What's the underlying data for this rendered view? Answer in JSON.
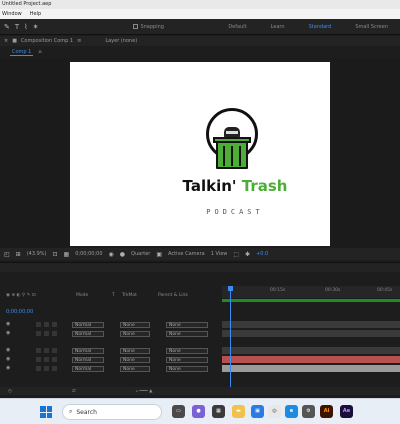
{
  "window": {
    "title": "Untitled Project.aep"
  },
  "menu": [
    "Window",
    "Help"
  ],
  "toolbar": {
    "tools": [
      "pen-tool",
      "text-tool",
      "brush-tool",
      "puppet-tool"
    ],
    "snapping_label": "Snapping",
    "workspaces": [
      {
        "label": "Default",
        "active": false
      },
      {
        "label": "Learn",
        "active": false
      },
      {
        "label": "Standard",
        "active": true
      },
      {
        "label": "Small Screen",
        "active": false
      }
    ]
  },
  "comp_panel": {
    "title": "Composition Comp 1",
    "layer_label": "Layer (none)",
    "active_tab": "Comp 1"
  },
  "artwork": {
    "word1": "Talkin'",
    "word2": "Trash",
    "tagline": "PODCAST"
  },
  "viewer_controls": {
    "zoom": "(43.9%)",
    "timecode": "0;00;00;00",
    "resolution": "Quarter",
    "camera": "Active Camera",
    "views": "1 View",
    "exposure": "+0.0"
  },
  "timeline": {
    "columns": [
      "Mode",
      "T",
      "TrkMat",
      "Parent & Link"
    ],
    "ruler": [
      "00:15s",
      "00:30s",
      "00:45s"
    ],
    "timecode": "0;00;00;00",
    "layers": [
      {
        "name": "",
        "mode": "Normal",
        "trkmat": "None",
        "parent": "None",
        "bar_color": "#3a3a3a"
      },
      {
        "name": "",
        "mode": "Normal",
        "trkmat": "None",
        "parent": "None",
        "bar_color": "#3a3a3a"
      },
      {
        "name": "",
        "mode": "Normal",
        "trkmat": "None",
        "parent": "None",
        "bar_color": "#3a3a3a"
      },
      {
        "name": "",
        "mode": "Normal",
        "trkmat": "None",
        "parent": "None",
        "bar_color": "#b95050"
      },
      {
        "name": "",
        "mode": "Normal",
        "trkmat": "None",
        "parent": "None",
        "bar_color": "#9a9a9a"
      }
    ]
  },
  "taskbar": {
    "search_placeholder": "Search",
    "apps": [
      "ai-icon",
      "ae-icon"
    ]
  },
  "colors": {
    "accent_blue": "#3a8cf0",
    "brand_green": "#4cae37",
    "workarea_green": "#1f8c2a"
  }
}
